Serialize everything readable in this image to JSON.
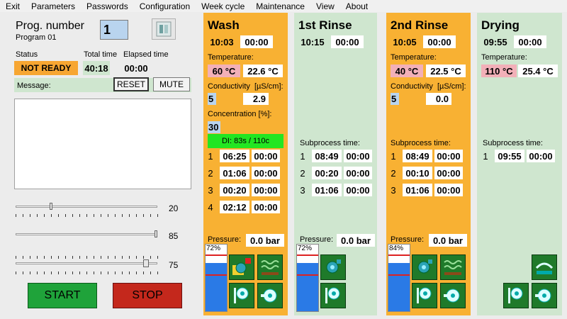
{
  "menu": [
    "Exit",
    "Parameters",
    "Passwords",
    "Configuration",
    "Week cycle",
    "Maintenance",
    "View",
    "About"
  ],
  "left": {
    "prog_label": "Prog. number",
    "prog_name": "Program 01",
    "prog_value": "1",
    "status_label": "Status",
    "status_value": "NOT READY",
    "total_label": "Total time",
    "total_value": "40:18",
    "elapsed_label": "Elapsed time",
    "elapsed_value": "00:00",
    "message_label": "Message:",
    "reset": "RESET",
    "mute": "MUTE",
    "slider1_value": "20",
    "slider2_value": "85",
    "slider3_value": "75",
    "start": "START",
    "stop": "STOP",
    "colors": {
      "status_bg": "#f7a632",
      "start": "#1fa33a",
      "stop": "#c4281c"
    }
  },
  "wash": {
    "title": "Wash",
    "t1": "10:03",
    "t2": "00:00",
    "temp_label": "Temperature:",
    "temp_set": "60 °C",
    "temp_act": "22.6 °C",
    "cond_label": "Conductivity",
    "cond_unit": "[µS/cm]:",
    "cond_set": "5",
    "cond_act": "2.9",
    "conc_label": "Concentration [%]:",
    "conc_value": "30",
    "di_label": "DI: 83s / 110c",
    "steps": [
      {
        "n": "1",
        "a": "06:25",
        "b": "00:00"
      },
      {
        "n": "2",
        "a": "01:06",
        "b": "00:00"
      },
      {
        "n": "3",
        "a": "00:20",
        "b": "00:00"
      },
      {
        "n": "4",
        "a": "02:12",
        "b": "00:00"
      }
    ],
    "pressure_label": "Pressure:",
    "pressure_value": "0.0 bar",
    "level": "72%"
  },
  "rinse1": {
    "title": "1st Rinse",
    "t1": "10:15",
    "t2": "00:00",
    "sub_label": "Subprocess time:",
    "steps": [
      {
        "n": "1",
        "a": "08:49",
        "b": "00:00"
      },
      {
        "n": "2",
        "a": "00:20",
        "b": "00:00"
      },
      {
        "n": "3",
        "a": "01:06",
        "b": "00:00"
      }
    ],
    "pressure_label": "Pressure:",
    "pressure_value": "0.0 bar",
    "level": "72%"
  },
  "rinse2": {
    "title": "2nd Rinse",
    "t1": "10:05",
    "t2": "00:00",
    "temp_label": "Temperature:",
    "temp_set": "40 °C",
    "temp_act": "22.5 °C",
    "cond_label": "Conductivity",
    "cond_unit": "[µS/cm]:",
    "cond_set": "5",
    "cond_act": "0.0",
    "sub_label": "Subprocess time:",
    "steps": [
      {
        "n": "1",
        "a": "08:49",
        "b": "00:00"
      },
      {
        "n": "2",
        "a": "00:10",
        "b": "00:00"
      },
      {
        "n": "3",
        "a": "01:06",
        "b": "00:00"
      }
    ],
    "pressure_label": "Pressure:",
    "pressure_value": "0.0 bar",
    "level": "84%"
  },
  "drying": {
    "title": "Drying",
    "t1": "09:55",
    "t2": "00:00",
    "temp_label": "Temperature:",
    "temp_set": "110 °C",
    "temp_act": "25.4 °C",
    "sub_label": "Subprocess time:",
    "steps": [
      {
        "n": "1",
        "a": "09:55",
        "b": "00:00"
      }
    ]
  },
  "theme": {
    "orange": "#f8b133",
    "green": "#cfe6cf",
    "pink": "#f2b0b8",
    "blue": "#b9d4ef",
    "di_green": "#22e622",
    "tank_blue": "#2a7ae6"
  }
}
